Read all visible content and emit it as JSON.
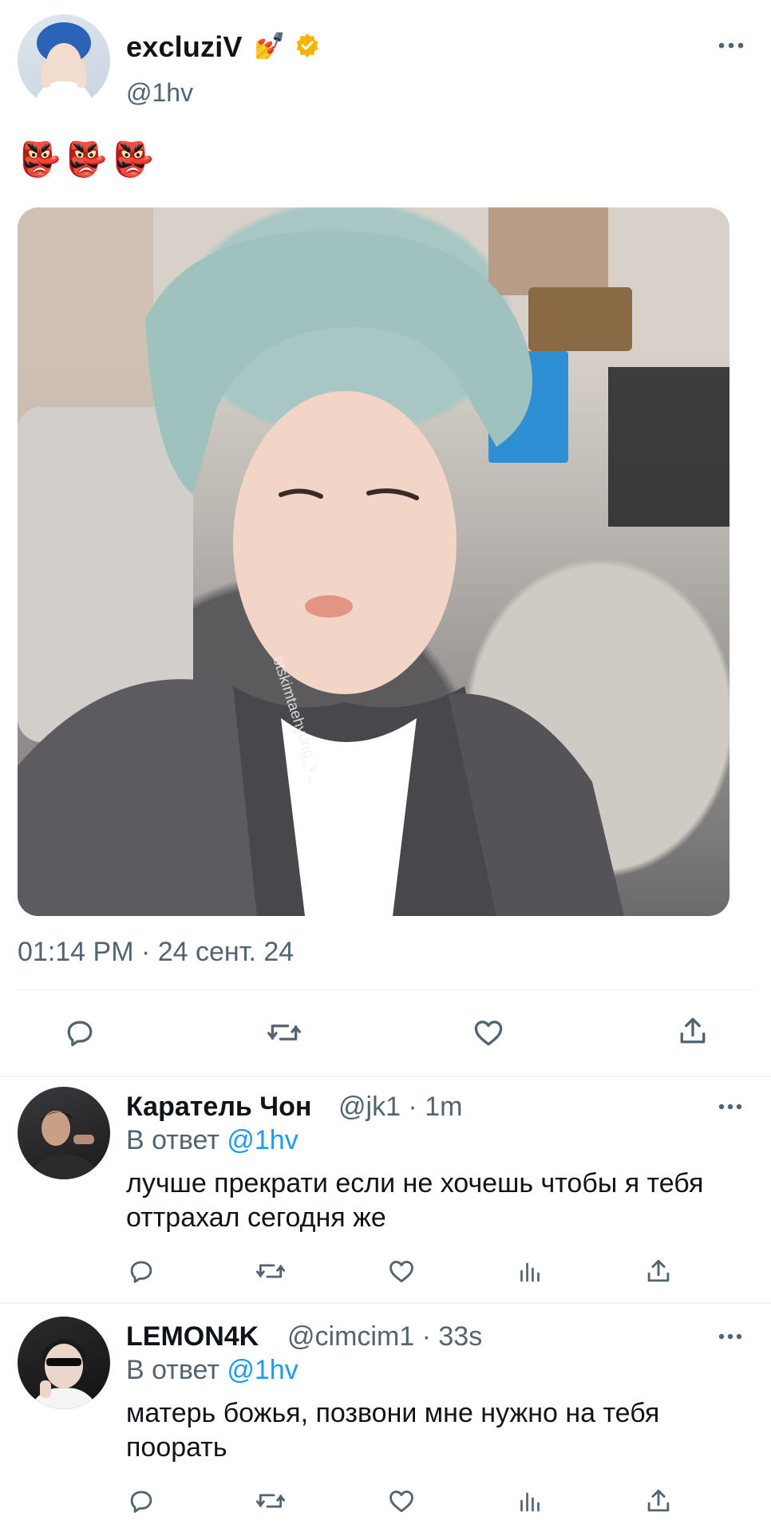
{
  "tweet": {
    "author": {
      "name": "excluziV",
      "name_emoji": "💅",
      "handle": "@1hv",
      "verified": true,
      "verified_color": "#f4b400"
    },
    "text": "👺👺👺",
    "media": {
      "watermark": "btskimtaehyung_v_"
    },
    "timestamp": "01:14 PM · 24 сент. 24",
    "actions": [
      "reply-icon",
      "retweet-icon",
      "like-icon",
      "share-icon"
    ]
  },
  "replies": [
    {
      "name": "Каратель Чон",
      "handle": "@jk1",
      "time": "1m",
      "meta": "@jk1 · 1m",
      "reply_to_label": "В ответ",
      "reply_to_handle": "@1hv",
      "text": "лучше прекрати если не хочешь чтобы я тебя оттрахал сегодня же",
      "actions": [
        "reply-icon",
        "retweet-icon",
        "like-icon",
        "views-icon",
        "share-icon"
      ]
    },
    {
      "name": "LEMON4K",
      "handle": "@cimcim1",
      "time": "33s",
      "meta": "@cimcim1 · 33s",
      "reply_to_label": "В ответ",
      "reply_to_handle": "@1hv",
      "text": "матерь божья, позвони мне нужно на тебя поорать",
      "actions": [
        "reply-icon",
        "retweet-icon",
        "like-icon",
        "views-icon",
        "share-icon"
      ]
    }
  ],
  "colors": {
    "text": "#0f1419",
    "secondary": "#536471",
    "link": "#1d9bf0",
    "divider": "#eff3f4"
  }
}
